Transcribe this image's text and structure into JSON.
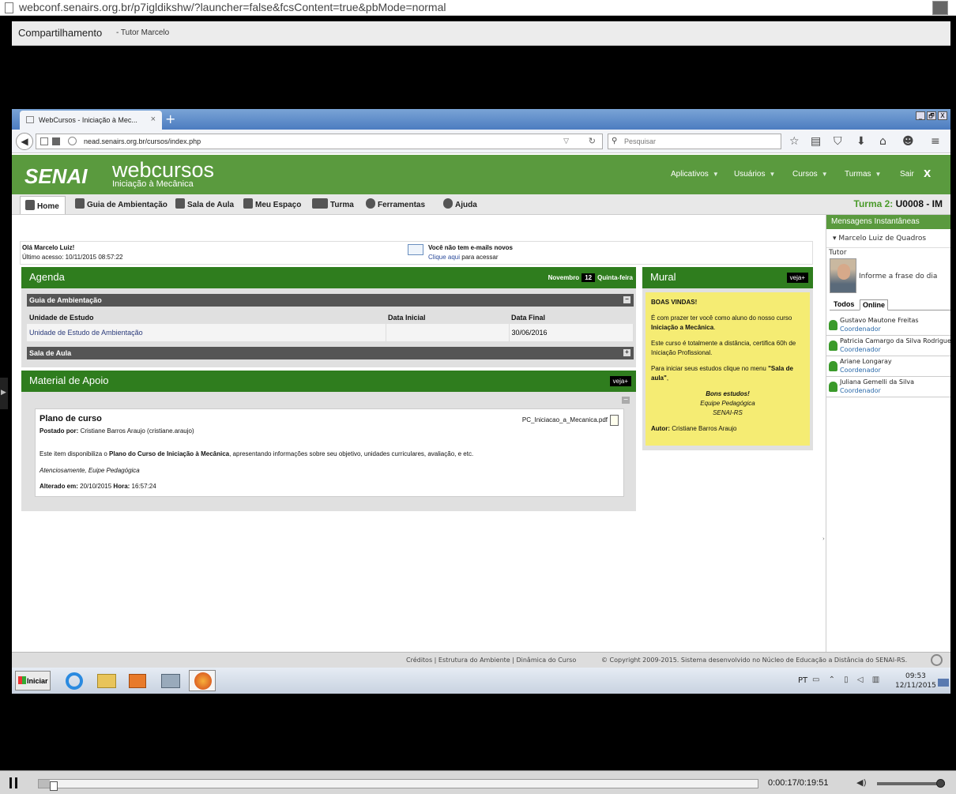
{
  "outer_browser": {
    "url": "webconf.senairs.org.br/p7igldikshw/?launcher=false&fcsContent=true&pbMode=normal"
  },
  "share_bar": {
    "title": "Compartilhamento",
    "presenter": "- Tutor Marcelo"
  },
  "firefox": {
    "tab_title": "WebCursos - Iniciação à Mec...",
    "tab_close": "×",
    "new_tab": "+",
    "address": "nead.senairs.org.br/cursos/index.php",
    "search_placeholder": "Pesquisar",
    "window_buttons": [
      "_",
      "🗗",
      "X"
    ]
  },
  "site_header": {
    "brand": "SENAI",
    "web_logo": "webcursos",
    "course": "Iniciação à Mecânica",
    "menu": [
      {
        "label": "Aplicativos"
      },
      {
        "label": "Usuários"
      },
      {
        "label": "Cursos"
      },
      {
        "label": "Turmas"
      },
      {
        "label": "Sair"
      }
    ],
    "close": "X"
  },
  "nav": {
    "items": [
      {
        "label": "Home"
      },
      {
        "label": "Guia de Ambientação"
      },
      {
        "label": "Sala de Aula"
      },
      {
        "label": "Meu Espaço"
      },
      {
        "label": "Turma"
      },
      {
        "label": "Ferramentas"
      },
      {
        "label": "Ajuda"
      }
    ],
    "turma_label": "Turma 2:",
    "turma_code": "U0008 - IM"
  },
  "greeting": {
    "hello": "Olá Marcelo Luiz!",
    "last_access": "Último acesso: 10/11/2015 08:57:22",
    "mail_status": "Você não tem e-mails novos",
    "mail_link": "Clique aqui",
    "mail_suffix": " para acessar"
  },
  "agenda": {
    "title": "Agenda",
    "month": "Novembro",
    "day": "12",
    "weekday": "Quinta-feira",
    "section1": "Guia de Ambientação",
    "section1_toggle": "−",
    "columns": [
      "Unidade de Estudo",
      "Data Inicial",
      "Data Final"
    ],
    "rows": [
      {
        "unit": "Unidade de Estudo de Ambientação",
        "start": "",
        "end": "30/06/2016"
      }
    ],
    "section2": "Sala de Aula",
    "section2_toggle": "+"
  },
  "material": {
    "title": "Material de Apoio",
    "more": "veja+",
    "toggle": "−",
    "card": {
      "title": "Plano de curso",
      "posted_label": "Postado por:",
      "posted_by": "Cristiane Barros Araujo (cristiane.araujo)",
      "file": "PC_Iniciacao_a_Mecanica.pdf",
      "desc_prefix": "Este item disponibiliza o ",
      "desc_bold": "Plano do Curso de Iniciação à Mecânica",
      "desc_suffix": ", apresentando informações sobre seu objetivo, unidades curriculares, avaliação, e etc.",
      "regards": "Atenciosamente, Euipe Pedagógica",
      "altered_label": "Alterado em:",
      "altered_date": "20/10/2015",
      "hour_label": "Hora:",
      "altered_time": "16:57:24"
    }
  },
  "mural": {
    "title": "Mural",
    "more": "veja+",
    "welcome": "BOAS VINDAS!",
    "p1_prefix": "É com prazer ter você como aluno do nosso curso ",
    "p1_bold": "Iniciação a Mecânica",
    "p1_suffix": ".",
    "p2": "Este curso é totalmente a distância, certifica 60h de Iniciação Profissional.",
    "p3_prefix": "Para iniciar seus estudos clique no menu ",
    "p3_bold": "\"Sala de aula\"",
    "p3_suffix": ",",
    "sign1": "Bons estudos!",
    "sign2": "Equipe Pedagógica",
    "sign3": "SENAI-RS",
    "author_label": "Autor:",
    "author": "Cristiane Barros Araujo"
  },
  "messenger": {
    "title": "Mensagens Instantâneas",
    "user": "Marcelo Luiz de Quadros",
    "role": "Tutor",
    "phrase_placeholder": "Informe a frase do dia",
    "tabs": [
      "Todos",
      "Online"
    ],
    "online": [
      {
        "name": "Gustavo Mautone Freitas",
        "role": "Coordenador"
      },
      {
        "name": "Patricia Camargo da Silva Rodrigues",
        "role": "Coordenador"
      },
      {
        "name": "Ariane Longaray",
        "role": "Coordenador"
      },
      {
        "name": "Juliana Gemelli da Silva",
        "role": "Coordenador"
      }
    ]
  },
  "footer": {
    "links": "Créditos  | Estrutura do Ambiente  | Dinâmica do Curso",
    "copyright": "© Copyright 2009-2015. Sistema desenvolvido no Núcleo de Educação a Distância do SENAI-RS."
  },
  "taskbar": {
    "start": "Iniciar",
    "lang": "PT",
    "time": "09:53",
    "date": "12/11/2015"
  },
  "player": {
    "time": "0:00:17/0:19:51",
    "progress": 0.015,
    "volume": 1.0
  }
}
